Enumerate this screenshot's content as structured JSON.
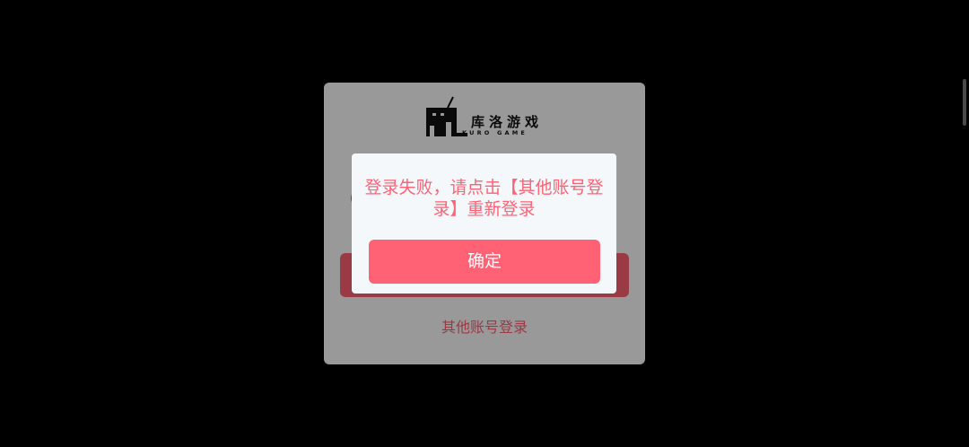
{
  "brand": {
    "name_cn": "库洛游戏",
    "name_en": "KURO GAME"
  },
  "login_panel": {
    "other_login_label": "其他账号登录"
  },
  "alert": {
    "message": "登录失败，请点击【其他账号登录】重新登录",
    "confirm_label": "确定"
  },
  "colors": {
    "accent": "#ff6274",
    "background": "#000000",
    "dialog_bg": "#f4f8fb"
  }
}
